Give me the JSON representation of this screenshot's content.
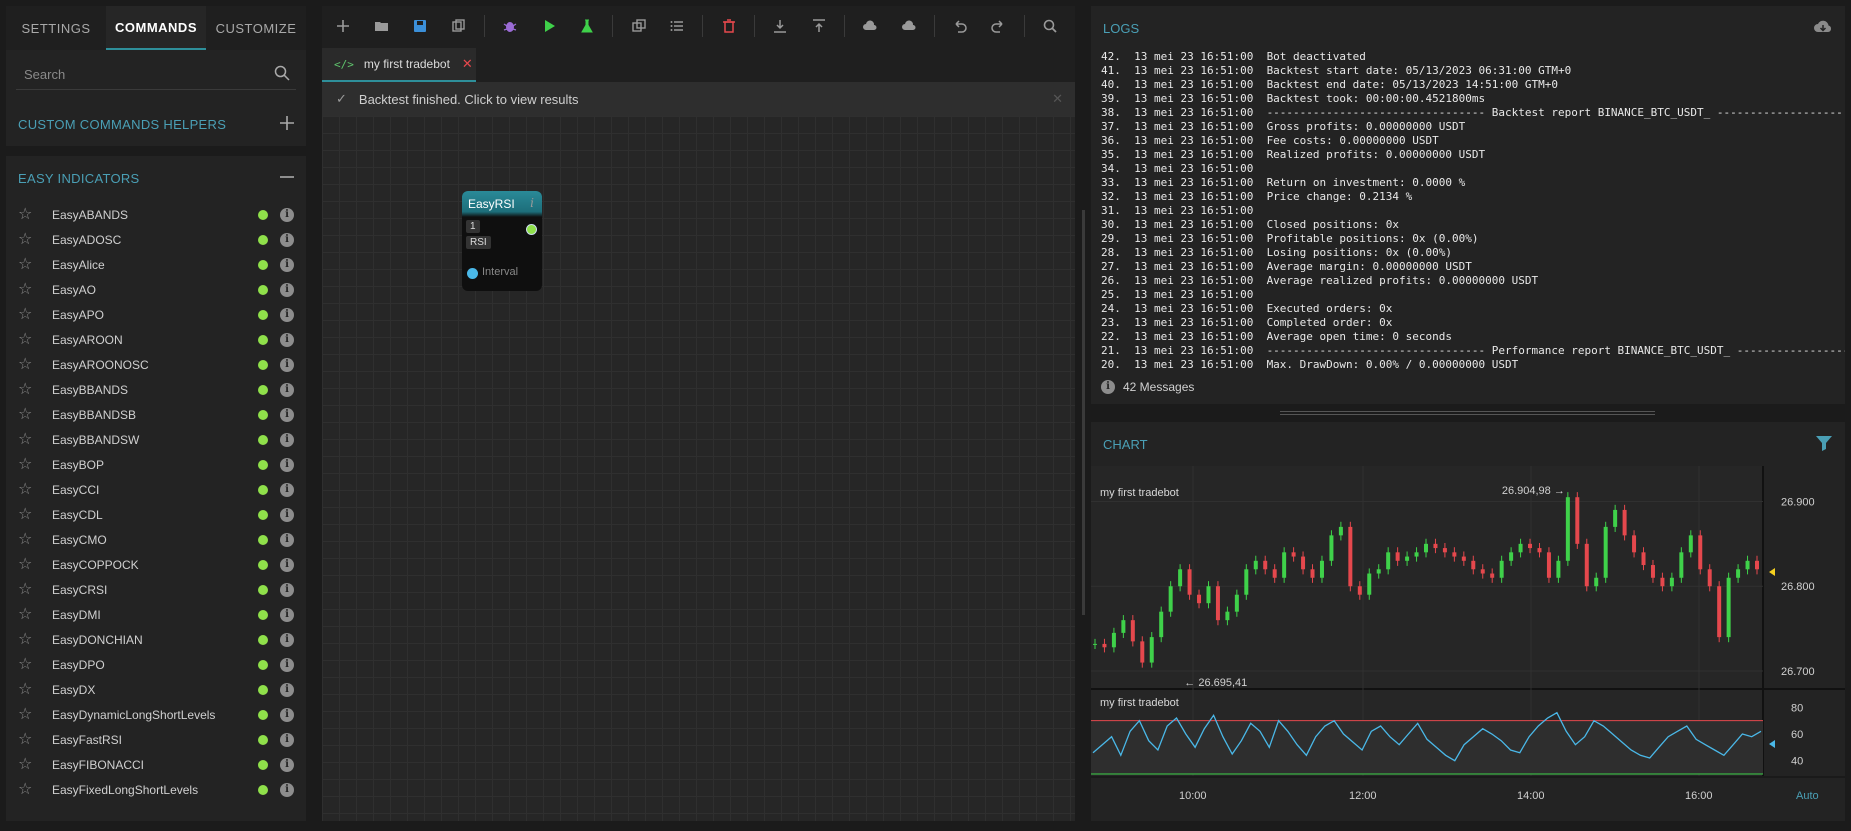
{
  "left": {
    "tabs": [
      {
        "label": "SETTINGS",
        "active": false
      },
      {
        "label": "COMMANDS",
        "active": true
      },
      {
        "label": "CUSTOMIZE",
        "active": false
      }
    ],
    "search_placeholder": "Search",
    "custom_section": "CUSTOM COMMANDS HELPERS",
    "easy_section": "EASY INDICATORS",
    "indicators": [
      "EasyABANDS",
      "EasyADOSC",
      "EasyAlice",
      "EasyAO",
      "EasyAPO",
      "EasyAROON",
      "EasyAROONOSC",
      "EasyBBANDS",
      "EasyBBANDSB",
      "EasyBBANDSW",
      "EasyBOP",
      "EasyCCI",
      "EasyCDL",
      "EasyCMO",
      "EasyCOPPOCK",
      "EasyCRSI",
      "EasyDMI",
      "EasyDONCHIAN",
      "EasyDPO",
      "EasyDX",
      "EasyDynamicLongShortLevels",
      "EasyFastRSI",
      "EasyFIBONACCI",
      "EasyFixedLongShortLevels"
    ]
  },
  "toolbar": {
    "icons": [
      "add-icon",
      "folder-open-icon",
      "save-icon",
      "copy-icon",
      "sep",
      "bug-icon",
      "play-icon",
      "flask-icon",
      "sep",
      "duplicate-icon",
      "list-icon",
      "sep",
      "trash-icon",
      "sep",
      "download-icon",
      "upload-icon",
      "sep",
      "cloud-download-icon",
      "cloud-upload-icon",
      "sep",
      "undo-icon",
      "redo-icon",
      "sep",
      "zoom-icon"
    ]
  },
  "editor": {
    "tab_label": "my first tradebot",
    "notice": "Backtest finished. Click to view results",
    "node": {
      "title": "EasyRSI",
      "value": "1",
      "type": "RSI",
      "input_label": "Interval"
    }
  },
  "logs": {
    "title": "LOGS",
    "lines": [
      "42.  13 mei 23 16:51:00  Bot deactivated",
      "41.  13 mei 23 16:51:00  Backtest start date: 05/13/2023 06:31:00 GTM+0",
      "40.  13 mei 23 16:51:00  Backtest end date: 05/13/2023 14:51:00 GTM+0",
      "39.  13 mei 23 16:51:00  Backtest took: 00:00:00.4521800ms",
      "38.  13 mei 23 16:51:00  --------------------------------- Backtest report BINANCE_BTC_USDT_ -------------------",
      "37.  13 mei 23 16:51:00  Gross profits: 0.00000000 USDT",
      "36.  13 mei 23 16:51:00  Fee costs: 0.00000000 USDT",
      "35.  13 mei 23 16:51:00  Realized profits: 0.00000000 USDT",
      "34.  13 mei 23 16:51:00",
      "33.  13 mei 23 16:51:00  Return on investment: 0.0000 %",
      "32.  13 mei 23 16:51:00  Price change: 0.2134 %",
      "31.  13 mei 23 16:51:00",
      "30.  13 mei 23 16:51:00  Closed positions: 0x",
      "29.  13 mei 23 16:51:00  Profitable positions: 0x (0.00%)",
      "28.  13 mei 23 16:51:00  Losing positions: 0x (0.00%)",
      "27.  13 mei 23 16:51:00  Average margin: 0.00000000 USDT",
      "26.  13 mei 23 16:51:00  Average realized profits: 0.00000000 USDT",
      "25.  13 mei 23 16:51:00",
      "24.  13 mei 23 16:51:00  Executed orders: 0x",
      "23.  13 mei 23 16:51:00  Completed order: 0x",
      "22.  13 mei 23 16:51:00  Average open time: 0 seconds",
      "21.  13 mei 23 16:51:00  --------------------------------- Performance report BINANCE_BTC_USDT_ -----------------",
      "20.  13 mei 23 16:51:00  Max. DrawDown: 0.00% / 0.00000000 USDT"
    ],
    "count_label": "42 Messages"
  },
  "chart_panel": {
    "title": "CHART",
    "auto_label": "Auto"
  },
  "chart_data": [
    {
      "type": "line",
      "title": "my first tradebot",
      "x_ticks": [
        "10:00",
        "12:00",
        "14:00",
        "16:00"
      ],
      "y_ticks": [
        26.9,
        26.8,
        26.7
      ],
      "y_tick_labels": [
        "26.900",
        "26.800",
        "26.700"
      ],
      "ylim": [
        26.68,
        26.93
      ],
      "high_label": "26.904,98",
      "low_label": "26.695,41",
      "series": [
        {
          "values": [
            26.732,
            26.728,
            26.745,
            26.76,
            26.735,
            26.71,
            26.74,
            26.77,
            26.8,
            26.82,
            26.79,
            26.78,
            26.8,
            26.76,
            26.77,
            26.79,
            26.82,
            26.83,
            26.82,
            26.81,
            26.84,
            26.835,
            26.82,
            26.81,
            26.83,
            26.86,
            26.87,
            26.8,
            26.79,
            26.815,
            26.82,
            26.84,
            26.83,
            26.835,
            26.84,
            26.85,
            26.845,
            26.84,
            26.835,
            26.83,
            26.82,
            26.815,
            26.81,
            26.83,
            26.84,
            26.85,
            26.845,
            26.84,
            26.81,
            26.83,
            26.905,
            26.85,
            26.8,
            26.81,
            26.87,
            26.89,
            26.86,
            26.84,
            26.825,
            26.81,
            26.8,
            26.81,
            26.84,
            26.86,
            26.82,
            26.8,
            26.74,
            26.81,
            26.82,
            26.83,
            26.82
          ]
        }
      ]
    },
    {
      "type": "line",
      "title": "my first tradebot",
      "x_ticks": [
        "10:00",
        "12:00",
        "14:00",
        "16:00"
      ],
      "y_ticks": [
        80,
        60,
        40
      ],
      "y_tick_labels": [
        "80",
        "60",
        "40"
      ],
      "ylim": [
        30,
        90
      ],
      "levels": [
        70,
        30
      ],
      "series": [
        {
          "values": [
            46,
            52,
            58,
            44,
            62,
            70,
            55,
            48,
            66,
            72,
            60,
            50,
            64,
            74,
            58,
            45,
            55,
            68,
            62,
            50,
            70,
            62,
            52,
            44,
            58,
            66,
            70,
            60,
            54,
            48,
            62,
            66,
            58,
            52,
            60,
            68,
            56,
            50,
            44,
            40,
            52,
            58,
            64,
            60,
            55,
            48,
            46,
            58,
            66,
            72,
            76,
            62,
            52,
            58,
            70,
            66,
            60,
            54,
            48,
            44,
            42,
            50,
            58,
            62,
            66,
            56,
            52,
            48,
            44,
            52,
            60,
            58,
            62
          ]
        }
      ]
    }
  ],
  "colors": {
    "accent": "#2e8f9a",
    "section": "#4a9fb5",
    "bull": "#3fd14a",
    "bear": "#e5484d",
    "rsi": "#4ab8e8"
  }
}
